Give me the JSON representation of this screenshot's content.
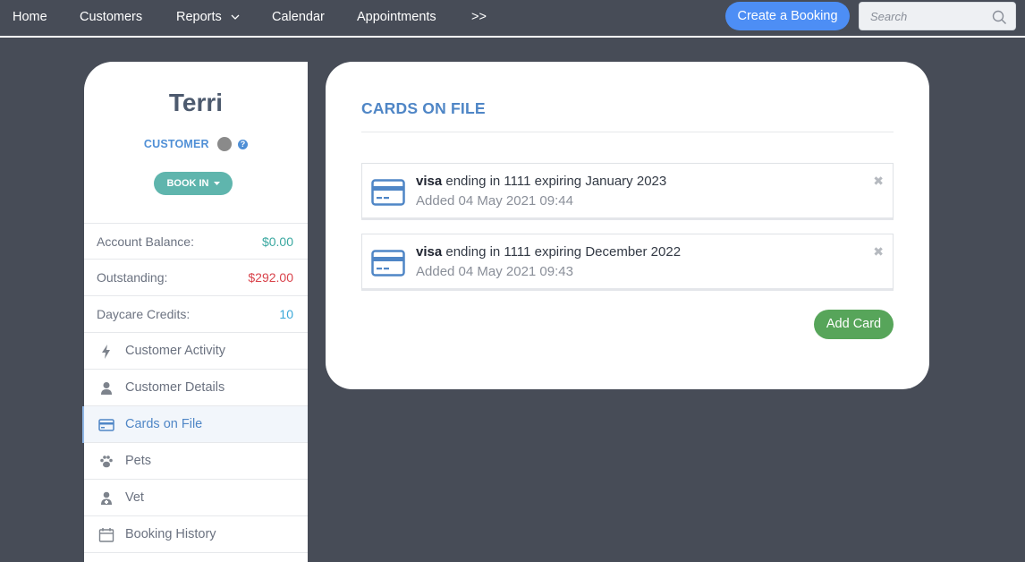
{
  "nav": {
    "items": [
      {
        "label": "Home"
      },
      {
        "label": "Customers"
      },
      {
        "label": "Reports"
      },
      {
        "label": "Calendar"
      },
      {
        "label": "Appointments"
      },
      {
        "label": ">>"
      }
    ],
    "create_booking": "Create a Booking",
    "search_placeholder": "Search"
  },
  "sidebar": {
    "name": "Terri",
    "role": "CUSTOMER",
    "help": "?",
    "book_in": "BOOK IN",
    "stats": [
      {
        "label": "Account Balance:",
        "value": "$0.00",
        "color": "#3aa8a0"
      },
      {
        "label": "Outstanding:",
        "value": "$292.00",
        "color": "#d9434b"
      },
      {
        "label": "Daycare Credits:",
        "value": "10",
        "color": "#3aa8d8"
      }
    ],
    "menu": [
      {
        "label": "Customer Activity",
        "icon": "bolt-icon"
      },
      {
        "label": "Customer Details",
        "icon": "user-icon"
      },
      {
        "label": "Cards on File",
        "icon": "credit-card-icon",
        "active": true
      },
      {
        "label": "Pets",
        "icon": "paw-icon"
      },
      {
        "label": "Vet",
        "icon": "doctor-icon"
      },
      {
        "label": "Booking History",
        "icon": "calendar-icon"
      }
    ]
  },
  "main": {
    "title": "CARDS ON FILE",
    "cards": [
      {
        "brand": "visa",
        "desc": " ending in 1111 expiring January 2023",
        "added": "Added 04 May 2021 09:44"
      },
      {
        "brand": "visa",
        "desc": " ending in 1111 expiring December 2022",
        "added": "Added 04 May 2021 09:43"
      }
    ],
    "add_card": "Add Card",
    "remove_glyph": "✖"
  }
}
